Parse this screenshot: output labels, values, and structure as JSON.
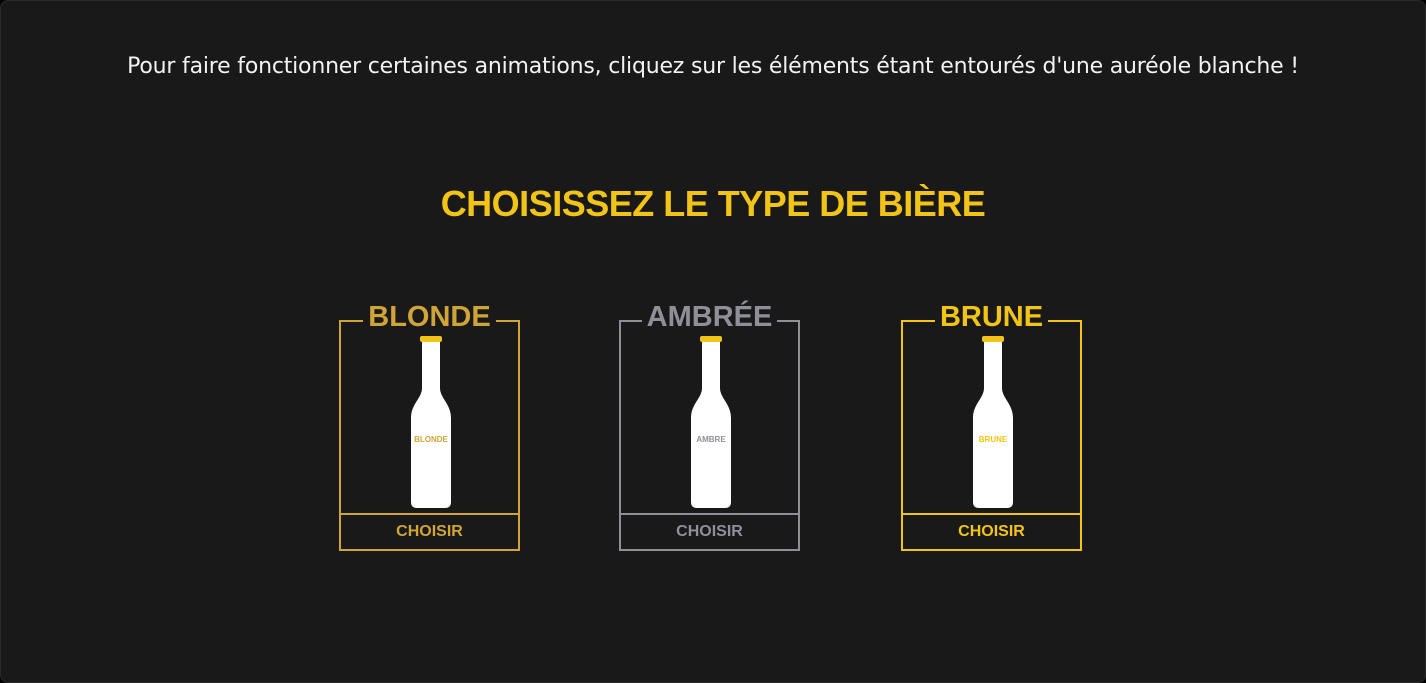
{
  "instruction": "Pour faire fonctionner certaines animations, cliquez sur les éléments étant entourés d'une auréole blanche !",
  "title": "CHOISISSEZ LE TYPE DE BIÈRE",
  "colors": {
    "background": "#191919",
    "title": "#f2c417",
    "instruction": "#f2f2f2",
    "bottle": "#ffffff",
    "cap": "#f2c417"
  },
  "beers": [
    {
      "name": "BLONDE",
      "bottle_label": "BLONDE",
      "button": "CHOISIR",
      "color": "#d1a43a"
    },
    {
      "name": "AMBRÉE",
      "bottle_label": "AMBRE",
      "button": "CHOISIR",
      "color": "#8f8f99"
    },
    {
      "name": "BRUNE",
      "bottle_label": "BRUNE",
      "button": "CHOISIR",
      "color": "#f2c417"
    }
  ]
}
